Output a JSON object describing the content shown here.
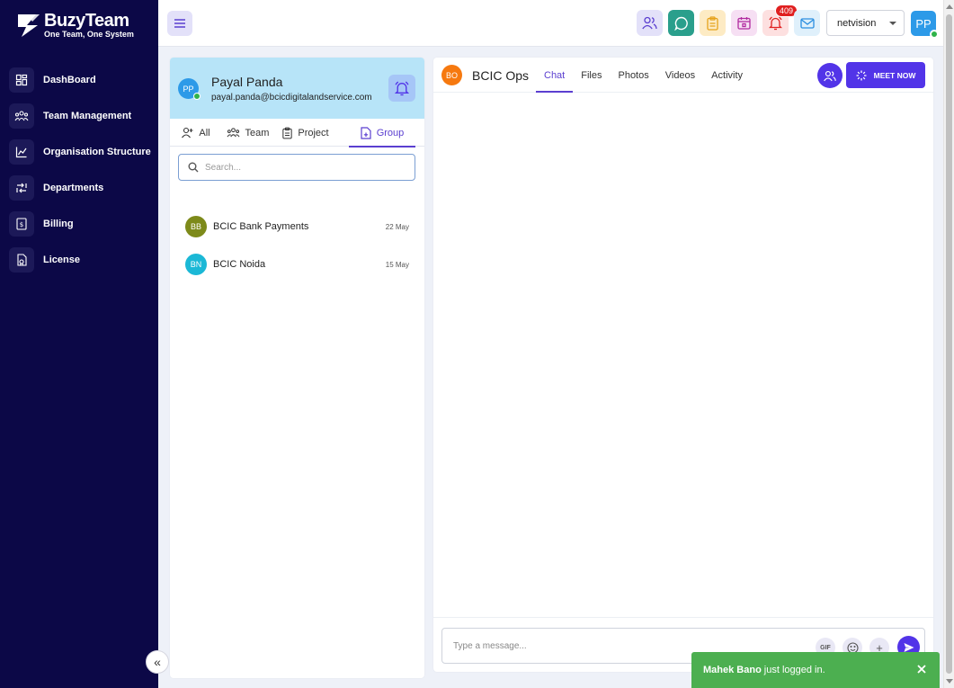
{
  "brand": {
    "name": "BuzyTeam",
    "tagline": "One Team, One System"
  },
  "sidebar": {
    "items": [
      {
        "label": "DashBoard",
        "icon": "dashboard-icon"
      },
      {
        "label": "Team Management",
        "icon": "team-icon"
      },
      {
        "label": "Organisation Structure",
        "icon": "org-chart-icon"
      },
      {
        "label": "Departments",
        "icon": "departments-icon"
      },
      {
        "label": "Billing",
        "icon": "billing-icon"
      },
      {
        "label": "License",
        "icon": "license-icon"
      }
    ],
    "collapse_glyph": "«"
  },
  "topbar": {
    "notifications_count": "409",
    "org_select": {
      "selected": "netvision"
    },
    "user_initials": "PP",
    "colors": {
      "people": "#e3e1f9",
      "chat": "#2a9f8c",
      "tasks": "#fdebc4",
      "calendar": "#f6dff3",
      "bell": "#fde0e0",
      "mail": "#dff0fb"
    }
  },
  "profile": {
    "initials": "PP",
    "name": "Payal Panda",
    "email": "payal.panda@bcicdigitalandservice.com"
  },
  "left_tabs": {
    "all": "All",
    "team": "Team",
    "project": "Project",
    "group": "Group",
    "active": "Group"
  },
  "search": {
    "placeholder": "Search..."
  },
  "groups": [
    {
      "initials": "BB",
      "name": "BCIC Bank Payments",
      "date": "22 May",
      "color": "#7d8a1a"
    },
    {
      "initials": "BN",
      "name": "BCIC Noida",
      "date": "15 May",
      "color": "#1bb8d6"
    }
  ],
  "chat": {
    "initials": "BO",
    "title": "BCIC Ops",
    "tabs": [
      "Chat",
      "Files",
      "Photos",
      "Videos",
      "Activity"
    ],
    "active_tab": "Chat",
    "meet_now": "MEET NOW",
    "message_placeholder": "Type a message...",
    "gif_label": "GIF",
    "plus_label": "+"
  },
  "toast": {
    "name": "Mahek Bano",
    "message": "just logged in."
  },
  "accent_color": "#5234e8",
  "sidebar_color": "#0c0847"
}
